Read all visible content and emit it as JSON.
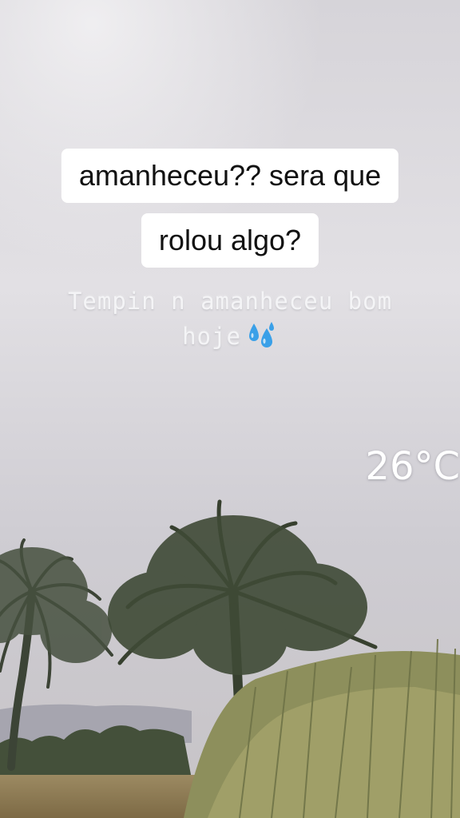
{
  "caption": {
    "line1": "amanheceu?? sera que",
    "line2": "rolou algo?"
  },
  "typed_text": {
    "line1": "Tempin n amanheceu bom",
    "line2": "hoje",
    "emoji": "sweat-droplets-icon"
  },
  "temperature": "26°C",
  "colors": {
    "sky": "#cfced3",
    "caption_bg": "#ffffff",
    "caption_text": "#111111",
    "droplet": "#3aa0e8"
  }
}
